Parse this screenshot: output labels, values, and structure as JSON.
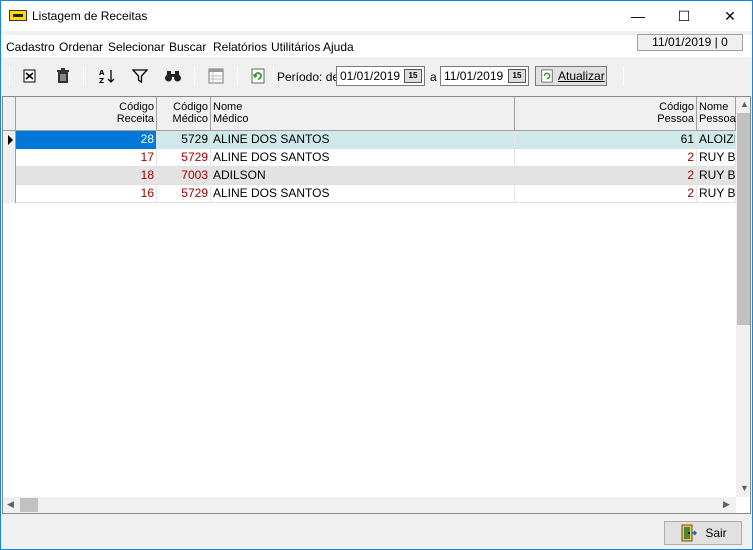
{
  "window": {
    "title": "Listagem de Receitas"
  },
  "menu": [
    {
      "label": "Cadastro"
    },
    {
      "label": "Ordenar"
    },
    {
      "label": "Selecionar"
    },
    {
      "label": "Buscar"
    },
    {
      "label": "Relatórios"
    },
    {
      "label": "Utilitários"
    },
    {
      "label": "Ajuda"
    }
  ],
  "status": {
    "date": "11/01/2019 | 0"
  },
  "toolbar": {
    "period_label": "Período: de",
    "to_label": "a",
    "date_from": "01/01/2019",
    "date_to": "11/01/2019",
    "cal_label": "15",
    "refresh_label": "Atualizar"
  },
  "grid": {
    "headers": {
      "cod_receita": "Código Receita",
      "cod_medico": "Código Médico",
      "nome_medico": "Nome Médico",
      "cod_pessoa": "Código Pessoa",
      "nome_pessoa": "Nome Pessoa"
    },
    "rows": [
      {
        "cod_receita": "28",
        "cod_medico": "5729",
        "nome_medico": "ALINE DOS SANTOS",
        "cod_pessoa": "61",
        "nome_pessoa": "ALOIZIO"
      },
      {
        "cod_receita": "17",
        "cod_medico": "5729",
        "nome_medico": "ALINE DOS SANTOS",
        "cod_pessoa": "2",
        "nome_pessoa": "RUY BA"
      },
      {
        "cod_receita": "18",
        "cod_medico": "7003",
        "nome_medico": "ADILSON",
        "cod_pessoa": "2",
        "nome_pessoa": "RUY BA"
      },
      {
        "cod_receita": "16",
        "cod_medico": "5729",
        "nome_medico": "ALINE DOS SANTOS",
        "cod_pessoa": "2",
        "nome_pessoa": "RUY BA"
      }
    ]
  },
  "footer": {
    "exit_label": "Sair"
  },
  "colors": {
    "selected": "#0078d7",
    "selected_row": "#cfe8ea",
    "alt_row": "#e3e3e3",
    "code_red": "#a00000"
  }
}
